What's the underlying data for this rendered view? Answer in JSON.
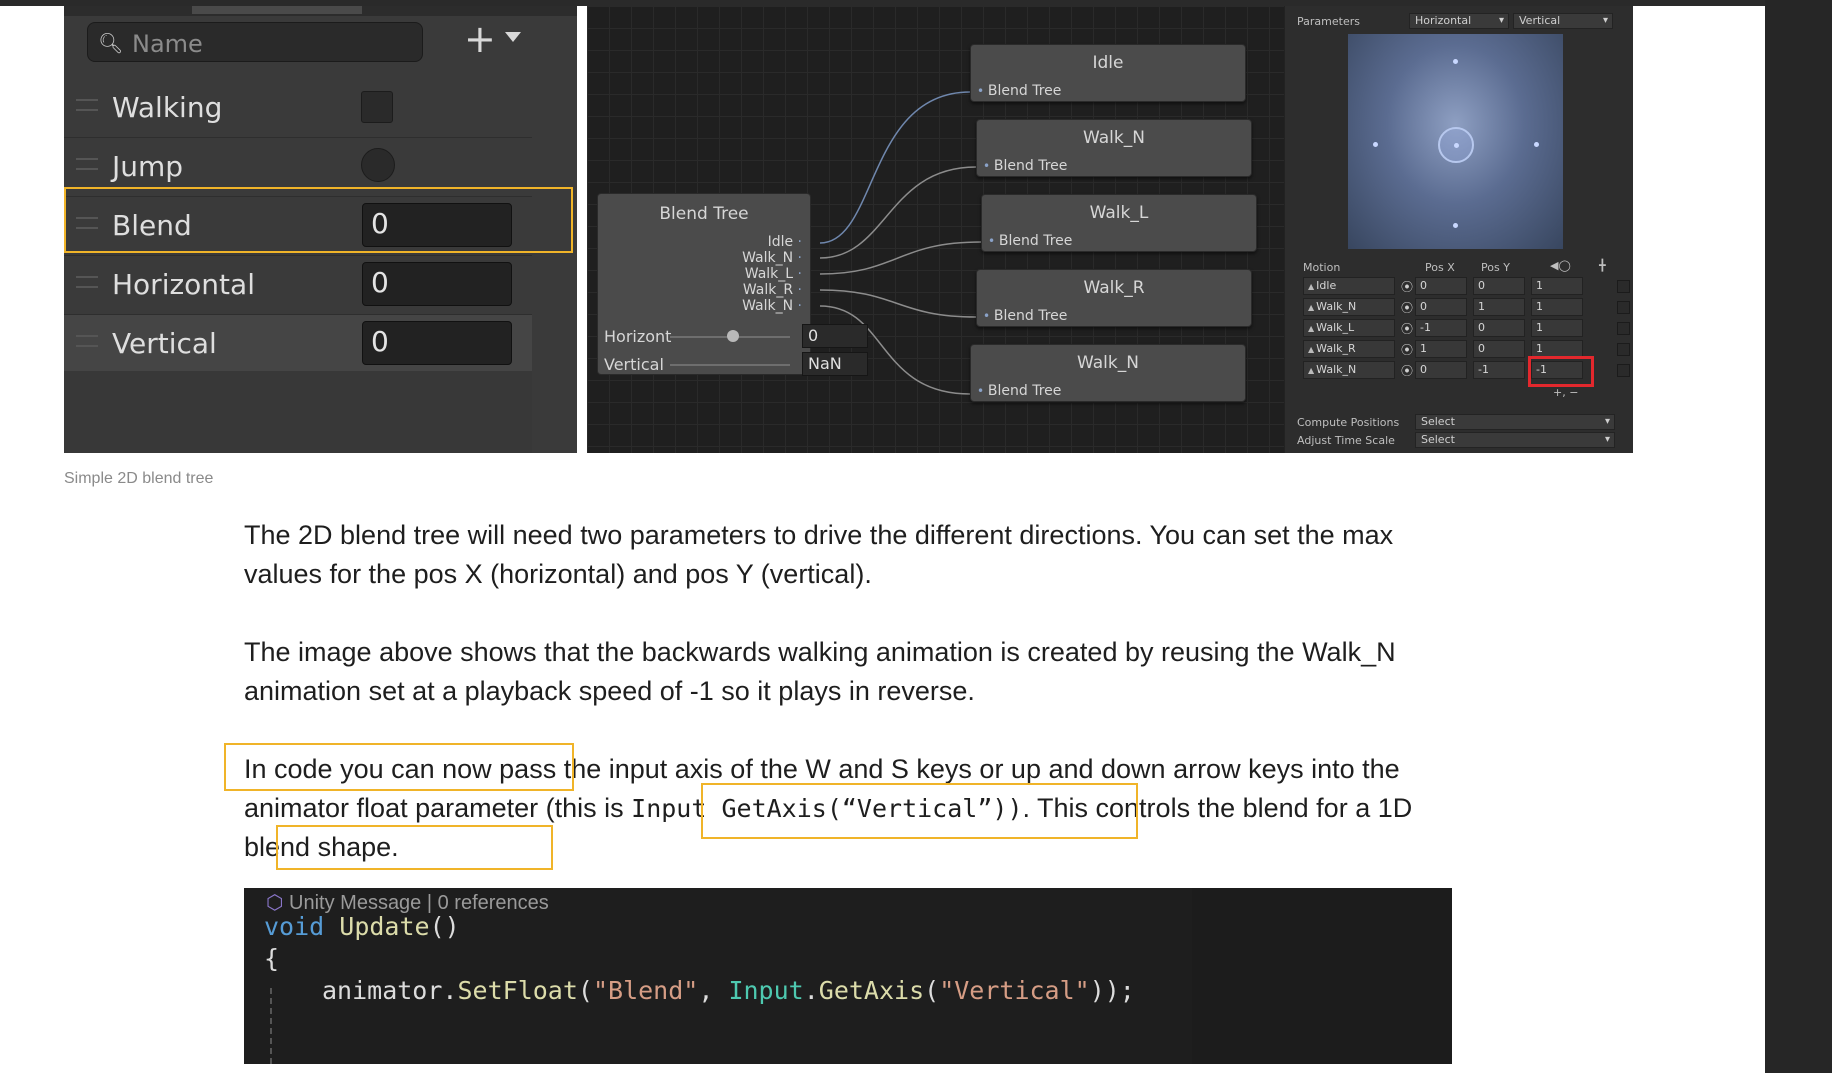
{
  "params_panel": {
    "search_placeholder": "Name",
    "add_label": "+",
    "rows": [
      {
        "name": "Walking",
        "kind": "bool"
      },
      {
        "name": "Jump",
        "kind": "trigger"
      },
      {
        "name": "Blend",
        "kind": "float",
        "value": "0"
      },
      {
        "name": "Horizontal",
        "kind": "float",
        "value": "0"
      },
      {
        "name": "Vertical",
        "kind": "float",
        "value": "0"
      }
    ]
  },
  "graph": {
    "blend_tree_title": "Blend Tree",
    "outputs": [
      "Idle",
      "Walk_N",
      "Walk_L",
      "Walk_R",
      "Walk_N"
    ],
    "inputs": [
      {
        "label": "Horizont",
        "value": "0"
      },
      {
        "label": "Vertical",
        "value": "NaN"
      }
    ],
    "children": [
      {
        "title": "Idle",
        "port": "Blend Tree"
      },
      {
        "title": "Walk_N",
        "port": "Blend Tree"
      },
      {
        "title": "Walk_L",
        "port": "Blend Tree"
      },
      {
        "title": "Walk_R",
        "port": "Blend Tree"
      },
      {
        "title": "Walk_N",
        "port": "Blend Tree"
      }
    ]
  },
  "inspector": {
    "parameters_label": "Parameters",
    "param_x": "Horizontal",
    "param_y": "Vertical",
    "motion_header": "Motion",
    "posx_header": "Pos X",
    "posy_header": "Pos Y",
    "motions": [
      {
        "name": "Idle",
        "posx": "0",
        "posy": "0",
        "speed": "1"
      },
      {
        "name": "Walk_N",
        "posx": "0",
        "posy": "1",
        "speed": "1"
      },
      {
        "name": "Walk_L",
        "posx": "-1",
        "posy": "0",
        "speed": "1"
      },
      {
        "name": "Walk_R",
        "posx": "1",
        "posy": "0",
        "speed": "1"
      },
      {
        "name": "Walk_N",
        "posx": "0",
        "posy": "-1",
        "speed": "-1"
      }
    ],
    "compute_label": "Compute Positions",
    "compute_value": "Select",
    "adjust_label": "Adjust Time Scale",
    "adjust_value": "Select",
    "add_remove": "+,  −"
  },
  "caption": "Simple 2D blend tree",
  "para1": "The 2D blend tree will need two parameters to drive the different directions. You can set the max values for the pos X (horizontal) and pos Y (vertical).",
  "para2": "The image above shows that the backwards walking animation is created by reusing the Walk_N animation set at a playback speed of -1 so it plays in reverse.",
  "para3": {
    "part1": "In code you can now pass",
    "part2": " the input axis of the W and S keys or up and down arrow keys into the animator float parameter (this is ",
    "code": "Input GetAxis(“Vertical”))",
    "part3": ". This controls the blend fo",
    "part4": "r",
    "part5": " a 1D blend shape."
  },
  "code": {
    "meta": "Unity Message | 0 references",
    "line1_kw": "void",
    "line1_fn": "Update",
    "line1_rest": "()",
    "line2": "{",
    "l3_obj": "animator",
    "l3_dot1": ".",
    "l3_fn1": "SetFloat",
    "l3_p1": "(",
    "l3_s1": "\"Blend\"",
    "l3_comma": ", ",
    "l3_ty": "Input",
    "l3_dot2": ".",
    "l3_fn2": "GetAxis",
    "l3_p2": "(",
    "l3_s2": "\"Vertical\"",
    "l3_end": "));"
  }
}
